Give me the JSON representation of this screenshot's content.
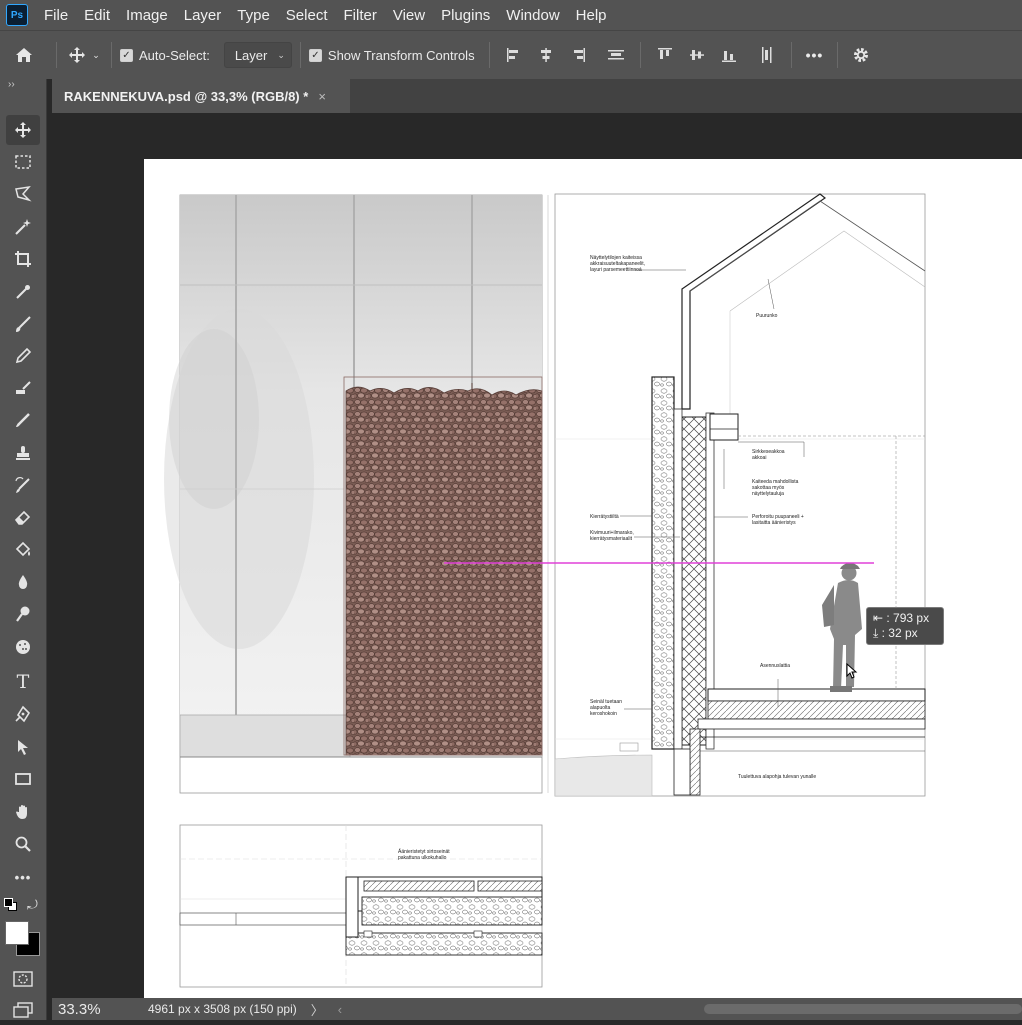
{
  "app": {
    "logo": "Ps"
  },
  "menu": [
    "File",
    "Edit",
    "Image",
    "Layer",
    "Type",
    "Select",
    "Filter",
    "View",
    "Plugins",
    "Window",
    "Help"
  ],
  "options": {
    "auto_select_label": "Auto-Select:",
    "auto_select_value": "Layer",
    "show_transform_label": "Show Transform Controls",
    "more_label": "•••"
  },
  "tab": {
    "title": "RAKENNEKUVA.psd @ 33,3% (RGB/8) *",
    "close": "×"
  },
  "status": {
    "zoom": "33.3%",
    "doc_info": "4961 px x 3508 px (150 ppi)"
  },
  "measure": {
    "dx": "⇤ : 793 px",
    "dy": "⤓ :   32 px"
  },
  "drawing": {
    "labels": {
      "l1": "Näyttelytilojen kaiteissa\nakkraisuuteltakapaneelit,\nlayuri parsemeettiinnoá",
      "l2": "Puurunko",
      "l3": "Sirkkeseakkoa\nakkoai",
      "l4": "Kaiteeda mahdollista\nsakottaa myös\nnäyttelytauluja",
      "l5": "Kierrätystiiltä",
      "l6": "Perforoitu puupaneeli +\nlasitaitta äänieristys",
      "l7": "Kivimuuri+ilmarako,\nkierrätysmateriaalit",
      "l8": "Asennuslattia",
      "l9": "Seinäl tuetaan\nalapuolta\nkeroshokoin",
      "l10": "Tuulettuva alapohja tulevan yunalle",
      "l11": "Äänieristetyt sirtoseinät\npakattuna ulkokuhallo"
    }
  }
}
